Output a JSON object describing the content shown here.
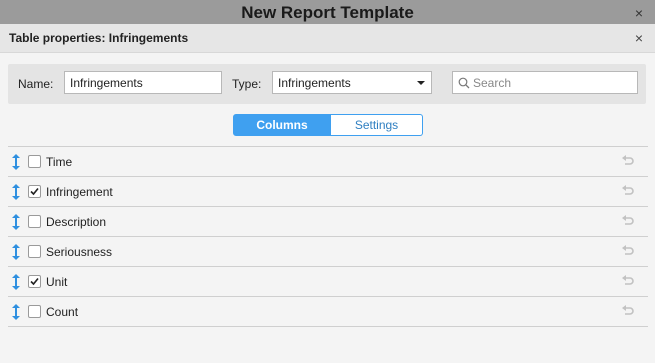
{
  "window": {
    "title": "New Report Template"
  },
  "dialog": {
    "title": "Table properties: Infringements"
  },
  "filter": {
    "name_label": "Name:",
    "name_value": "Infringements",
    "type_label": "Type:",
    "type_value": "Infringements",
    "search_placeholder": "Search"
  },
  "tabs": [
    {
      "label": "Columns",
      "active": true
    },
    {
      "label": "Settings",
      "active": false
    }
  ],
  "columns": [
    {
      "label": "Time",
      "checked": false
    },
    {
      "label": "Infringement",
      "checked": true
    },
    {
      "label": "Description",
      "checked": false
    },
    {
      "label": "Seriousness",
      "checked": false
    },
    {
      "label": "Unit",
      "checked": true
    },
    {
      "label": "Count",
      "checked": false
    }
  ],
  "colors": {
    "accent": "#3fa0f0",
    "drag_icon": "#2e8fe0",
    "undo_icon": "#c2c2c2"
  }
}
